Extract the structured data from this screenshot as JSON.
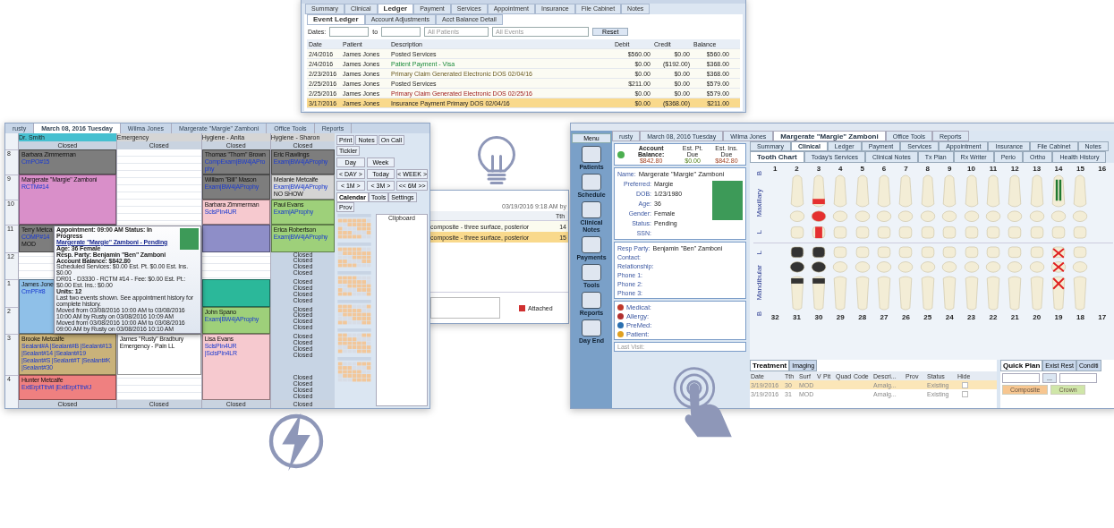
{
  "ledger": {
    "tabs": [
      {
        "label": "Summary",
        "selected": false
      },
      {
        "label": "Clinical",
        "selected": false
      },
      {
        "label": "Ledger",
        "selected": true
      },
      {
        "label": "Payment",
        "selected": false
      },
      {
        "label": "Services",
        "selected": false
      },
      {
        "label": "Appointment",
        "selected": false
      },
      {
        "label": "Insurance",
        "selected": false
      },
      {
        "label": "File Cabinet",
        "selected": false
      },
      {
        "label": "Notes",
        "selected": false
      }
    ],
    "subtabs": [
      {
        "label": "Event Ledger",
        "selected": true
      },
      {
        "label": "Account Adjustments",
        "selected": false
      },
      {
        "label": "Acct Balance Detail",
        "selected": false
      }
    ],
    "filters": {
      "dates_label": "Dates:",
      "to_label": "to",
      "patients_placeholder": "All Patients",
      "events_placeholder": "All Events",
      "reset": "Reset"
    },
    "columns": [
      "Date",
      "Patient",
      "Description",
      "Debit",
      "Credit",
      "Balance"
    ],
    "rows": [
      {
        "date": "2/4/2016",
        "patient": "James Jones",
        "description": "Posted Services",
        "kind": "service",
        "debit": "$560.00",
        "credit": "$0.00",
        "balance": "$560.00",
        "selected": false
      },
      {
        "date": "2/4/2016",
        "patient": "James Jones",
        "description": "Patient Payment - Visa",
        "kind": "payment",
        "debit": "$0.00",
        "credit": "($192.00)",
        "balance": "$368.00",
        "selected": false
      },
      {
        "date": "2/23/2016",
        "patient": "James Jones",
        "description": "Primary Claim Generated Electronic DOS 02/04/16",
        "kind": "claim",
        "debit": "$0.00",
        "credit": "$0.00",
        "balance": "$368.00",
        "selected": false
      },
      {
        "date": "2/25/2016",
        "patient": "James Jones",
        "description": "Posted Services",
        "kind": "service",
        "debit": "$211.00",
        "credit": "$0.00",
        "balance": "$579.00",
        "selected": false
      },
      {
        "date": "2/25/2016",
        "patient": "James Jones",
        "description": "Primary Claim Generated Electronic DOS 02/25/16",
        "kind": "rejected-claim",
        "debit": "$0.00",
        "credit": "$0.00",
        "balance": "$579.00",
        "selected": false
      },
      {
        "date": "3/17/2016",
        "patient": "James Jones",
        "description": "Insurance Payment Primary DOS 02/04/16",
        "kind": "service",
        "debit": "$0.00",
        "credit": "($368.00)",
        "balance": "$211.00",
        "selected": true
      }
    ]
  },
  "schedule": {
    "tabs": [
      {
        "label": "rusty",
        "selected": false
      },
      {
        "label": "March 08, 2016 Tuesday",
        "selected": true
      },
      {
        "label": "Wilma Jones",
        "selected": false
      },
      {
        "label": "Margerate \"Margie\" Zamboni",
        "selected": false
      },
      {
        "label": "Office Tools",
        "selected": false
      },
      {
        "label": "Reports",
        "selected": false
      }
    ],
    "hours": [
      "8",
      "9",
      "10",
      "11",
      "12",
      "1",
      "2",
      "3",
      "4"
    ],
    "providers": [
      {
        "name": "Dr. Smith",
        "selected": true,
        "top_label": "Closed",
        "bottom_label": "Closed",
        "slots": [
          {
            "kind": "appointment",
            "patient": "Barbara Zimmerman",
            "procedures": "CmPO#15",
            "color": "#7d7d7d"
          },
          {
            "kind": "long-appointment",
            "patient": "Margerate \"Margie\" Zamboni",
            "procedures": "RCTM#14",
            "color": "#d98fc9"
          },
          {
            "kind": "appointment",
            "patient": "Terry Metca",
            "procedures": "COMP#14",
            "note": "MOD",
            "color": "#7d7d7d"
          },
          {
            "kind": "empty"
          },
          {
            "kind": "long-appointment",
            "patient": "James Jone",
            "procedures": "CmPF#8",
            "color": "#8fc0e8"
          },
          {
            "kind": "appointment",
            "patient": "Brooke Metcalfe",
            "procedures": "Sealant#A |Sealant#B |Sealant#13 |Sealant#14 |Sealant#19 |Sealant#S |Sealant#T |Sealant#K |Sealant#30",
            "color": "#c9b27a"
          },
          {
            "kind": "appointment",
            "patient": "Hunter Metcalfe",
            "procedures": "ExtErptTth#I |ExtErptTth#J",
            "color": "#ef8080"
          }
        ]
      },
      {
        "name": "Emergency",
        "selected": false,
        "top_label": "Closed",
        "bottom_label": "Closed",
        "slots": [
          {
            "kind": "empty"
          },
          {
            "kind": "empty"
          },
          {
            "kind": "empty"
          },
          {
            "kind": "empty"
          },
          {
            "kind": "empty"
          },
          {
            "kind": "empty"
          },
          {
            "kind": "empty"
          },
          {
            "kind": "appointment",
            "patient": "James \"Rusty\" Bradbury",
            "note": "Emergency - Pain LL",
            "color": "#ffffff"
          }
        ]
      },
      {
        "name": "Hygiene - Anita",
        "selected": false,
        "top_label": "Closed",
        "bottom_label": "Closed",
        "slots": [
          {
            "kind": "appointment",
            "patient": "Thomas \"Thom\" Brown",
            "procedures": "CompExam|BW4|AProphy",
            "color": "#7d7d7d"
          },
          {
            "kind": "appointment",
            "patient": "William \"Bill\" Mason",
            "procedures": "Exam|BW4|AProphy",
            "color": "#7d7d7d"
          },
          {
            "kind": "appointment",
            "patient": "Barbara Zimmerman",
            "procedures": "SclsPIn4UR",
            "color": "#f6c9cf"
          },
          {
            "kind": "appointment",
            "color": "#8e8ec8"
          },
          {
            "kind": "empty"
          },
          {
            "kind": "appointment",
            "color": "#2bb89a"
          },
          {
            "kind": "appointment",
            "patient": "John Spano",
            "procedures": "Exam|BW4|AProphy",
            "color": "#9ed07a"
          },
          {
            "kind": "long-appointment",
            "patient": "Lisa Evans",
            "procedures": "SclsPIn4UR |SclsPIn4LR",
            "color": "#f6c9cf"
          }
        ]
      },
      {
        "name": "Hygiene - Sharon",
        "selected": false,
        "top_label": "Closed",
        "bottom_label": "Closed",
        "slots": [
          {
            "kind": "appointment",
            "patient": "Eric Rawlings",
            "procedures": "Exam|BW4|AProphy",
            "color": "#7d7d7d"
          },
          {
            "kind": "appointment",
            "patient": "Melanie Metcalfe",
            "procedures": "Exam|BW4|AProphy",
            "note": "NO SHOW",
            "color": "#d4d4d4"
          },
          {
            "kind": "appointment",
            "patient": "Paul Evans",
            "procedures": "Exam|AProphy",
            "color": "#9ed07a"
          },
          {
            "kind": "appointment",
            "patient": "Erica Robertson",
            "procedures": "Exam|BW4|AProphy",
            "color": "#9ed07a"
          },
          {
            "kind": "closed",
            "labels": [
              "Closed",
              "Closed",
              "Closed",
              "Closed"
            ]
          },
          {
            "kind": "closed",
            "labels": [
              "Closed",
              "Closed",
              "Closed",
              "Closed"
            ]
          },
          {
            "kind": "closed",
            "labels": [
              "Closed",
              "Closed",
              "Closed",
              "Closed"
            ]
          },
          {
            "kind": "closed",
            "labels": [
              "Closed",
              "Closed",
              "Closed",
              "Closed"
            ]
          },
          {
            "kind": "closed",
            "labels": [
              "Closed",
              "Closed",
              "Closed",
              "Closed"
            ]
          }
        ]
      }
    ],
    "popup": {
      "lines": [
        {
          "text": "Appointment: 09:00 AM  Status: In Progress",
          "kind": "bold"
        },
        {
          "text": "Margerate \"Margie\" Zamboni - Pending",
          "kind": "link"
        },
        {
          "text": "Age: 36  Female",
          "kind": "bold"
        },
        {
          "text": "Resp. Party: Benjamin \"Ben\" Zamboni",
          "kind": "bold"
        },
        {
          "text": "Account Balance: $842.80",
          "kind": "bold"
        },
        {
          "text": "Scheduled Services: $0.00  Est. Pt. $0.00  Est. Ins. $0.00",
          "kind": "plain"
        },
        {
          "text": "DR01 - D3330 - RCTM #14 - Fee: $0.00 Est. Pt.: $0.00 Est. Ins.: $0.00",
          "kind": "plain"
        },
        {
          "text": "Units: 12",
          "kind": "bold"
        },
        {
          "text": "Last two events shown.  See appointment history for complete history.",
          "kind": "plain"
        },
        {
          "text": "Moved from 03/08/2016 10:00 AM to 03/08/2016 10:00 AM by Rusty on 03/08/2016 10:09 AM",
          "kind": "plain"
        },
        {
          "text": "Moved from 03/08/2016 10:00 AM to 03/08/2016 09:00 AM by Rusty on 03/08/2016 10:10 AM",
          "kind": "plain"
        }
      ]
    },
    "toolbar": [
      "Print",
      "Notes",
      "On Call",
      "Tickler"
    ],
    "view_buttons": [
      {
        "label": "Day",
        "selected": false
      },
      {
        "label": "Week",
        "selected": false
      }
    ],
    "nav_buttons": [
      "< DAY >",
      "Today",
      "< WEEK >",
      "< 1M >",
      "< 3M >",
      "<< 6M >>"
    ],
    "panel_tabs": [
      {
        "label": "Calendar",
        "selected": true
      },
      {
        "label": "Tools",
        "selected": false
      },
      {
        "label": "Settings",
        "selected": false
      },
      {
        "label": "Prov",
        "selected": false
      }
    ],
    "clipboard_label": "Clipboard"
  },
  "middle": {
    "timestamp": "03/19/2016 9:18 AM by",
    "column": "Tth",
    "rows": [
      {
        "description": "composite - three surface, posterior",
        "tooth": "14",
        "selected": false
      },
      {
        "description": "composite - three surface, posterior",
        "tooth": "15",
        "selected": true
      }
    ],
    "attached_label": "Attached"
  },
  "chart": {
    "menu": "Menu",
    "sidebar": [
      "Patients",
      "Schedule",
      "Clinical Notes",
      "Payments",
      "Tools",
      "Reports",
      "Day End"
    ],
    "tabs": [
      {
        "label": "rusty",
        "selected": false
      },
      {
        "label": "March 08, 2016 Tuesday",
        "selected": false
      },
      {
        "label": "Wilma Jones",
        "selected": false
      },
      {
        "label": "Margerate \"Margie\" Zamboni",
        "selected": true
      },
      {
        "label": "Office Tools",
        "selected": false
      },
      {
        "label": "Reports",
        "selected": false
      }
    ],
    "balance": {
      "label": "Account Balance:",
      "amount": "$842.80",
      "pt_label": "Est. Pt. Due",
      "pt_value": "$0.00",
      "ins_label": "Est. Ins. Due",
      "ins_value": "$842.80"
    },
    "name": {
      "label": "Name:",
      "value": "Margerate \"Margie\" Zamboni"
    },
    "patient": [
      {
        "label": "Preferred:",
        "value": "Margie"
      },
      {
        "label": "DOB:",
        "value": "1/23/1980"
      },
      {
        "label": "Age:",
        "value": "36"
      },
      {
        "label": "Gender:",
        "value": "Female"
      },
      {
        "label": "Status:",
        "value": "Pending"
      },
      {
        "label": "SSN:"
      }
    ],
    "resp": [
      {
        "label": "Resp Party:",
        "value": "Benjamin \"Ben\" Zamboni"
      },
      {
        "label": "Contact:"
      },
      {
        "label": "Relationship:"
      },
      {
        "label": "Phone 1:"
      },
      {
        "label": "Phone 2:"
      },
      {
        "label": "Phone 3:"
      }
    ],
    "alerts": [
      {
        "label": "Medical:",
        "kind": "medical"
      },
      {
        "label": "Allergy:",
        "kind": "allergy"
      },
      {
        "label": "PreMed:",
        "kind": "premed"
      },
      {
        "label": "Patient:",
        "kind": "patient"
      }
    ],
    "last_visit": "Last Visit:",
    "section_tabs": [
      {
        "label": "Summary",
        "selected": false
      },
      {
        "label": "Clinical",
        "selected": true
      },
      {
        "label": "Ledger",
        "selected": false
      },
      {
        "label": "Payment",
        "selected": false
      },
      {
        "label": "Services",
        "selected": false
      },
      {
        "label": "Appointment",
        "selected": false
      },
      {
        "label": "Insurance",
        "selected": false
      },
      {
        "label": "File Cabinet",
        "selected": false
      },
      {
        "label": "Notes",
        "selected": false
      }
    ],
    "clinical_tabs": [
      {
        "label": "Tooth Chart",
        "selected": true
      },
      {
        "label": "Today's Services",
        "selected": false
      },
      {
        "label": "Clinical Notes",
        "selected": false
      },
      {
        "label": "Tx Plan",
        "selected": false
      },
      {
        "label": "Rx Writer",
        "selected": false
      },
      {
        "label": "Perio",
        "selected": false
      },
      {
        "label": "Ortho",
        "selected": false
      },
      {
        "label": "Health History",
        "selected": false
      }
    ],
    "upper_labels": [
      "B",
      "Maxillary",
      "L"
    ],
    "lower_labels": [
      "L",
      "Mandibular",
      "B"
    ],
    "upper_teeth": [
      {
        "number": "1",
        "kind": "absent"
      },
      {
        "number": "2",
        "kind": "sound"
      },
      {
        "number": "3",
        "kind": "filled"
      },
      {
        "number": "4",
        "kind": "sound"
      },
      {
        "number": "5",
        "kind": "sound"
      },
      {
        "number": "6",
        "kind": "sound"
      },
      {
        "number": "7",
        "kind": "sound"
      },
      {
        "number": "8",
        "kind": "sound"
      },
      {
        "number": "9",
        "kind": "sound"
      },
      {
        "number": "10",
        "kind": "sound"
      },
      {
        "number": "11",
        "kind": "sound"
      },
      {
        "number": "12",
        "kind": "sound"
      },
      {
        "number": "13",
        "kind": "sound"
      },
      {
        "number": "14",
        "kind": "root-canal"
      },
      {
        "number": "15",
        "kind": "sound"
      },
      {
        "number": "16",
        "kind": "absent"
      }
    ],
    "lower_teeth": [
      {
        "number": "32",
        "kind": "absent"
      },
      {
        "number": "31",
        "kind": "amalgam"
      },
      {
        "number": "30",
        "kind": "amalgam"
      },
      {
        "number": "29",
        "kind": "sound"
      },
      {
        "number": "28",
        "kind": "sound"
      },
      {
        "number": "27",
        "kind": "sound"
      },
      {
        "number": "26",
        "kind": "sound"
      },
      {
        "number": "25",
        "kind": "sound"
      },
      {
        "number": "24",
        "kind": "sound"
      },
      {
        "number": "23",
        "kind": "sound"
      },
      {
        "number": "22",
        "kind": "sound"
      },
      {
        "number": "21",
        "kind": "sound"
      },
      {
        "number": "20",
        "kind": "sound"
      },
      {
        "number": "19",
        "kind": "extracted"
      },
      {
        "number": "18",
        "kind": "sound"
      },
      {
        "number": "17",
        "kind": "absent"
      }
    ],
    "treatment_tabs": [
      {
        "label": "Treatment",
        "selected": true
      },
      {
        "label": "Imaging",
        "selected": false
      }
    ],
    "treatment_columns": [
      "Date",
      "Tth",
      "Surf",
      "V",
      "Pit",
      "Quad",
      "Code",
      "Descri...",
      "Prov",
      "Status",
      "Hide"
    ],
    "treatment_rows": [
      {
        "date": "3/19/2016",
        "tooth": "30",
        "surface": "MOD",
        "description": "Amalg...",
        "status": "Existing",
        "hidden": false,
        "selected": true
      },
      {
        "date": "3/19/2016",
        "tooth": "31",
        "surface": "MOD",
        "description": "Amalg...",
        "status": "Existing",
        "hidden": false,
        "selected": false
      }
    ],
    "plan_tabs": [
      {
        "label": "Quick Plan",
        "selected": true
      },
      {
        "label": "Exist Rest",
        "selected": false
      },
      {
        "label": "Conditi",
        "selected": false
      }
    ],
    "plan_more": "...",
    "plan_buttons": [
      {
        "label": "Composite",
        "kind": "composite"
      },
      {
        "label": "Crown",
        "kind": "crown"
      }
    ]
  }
}
